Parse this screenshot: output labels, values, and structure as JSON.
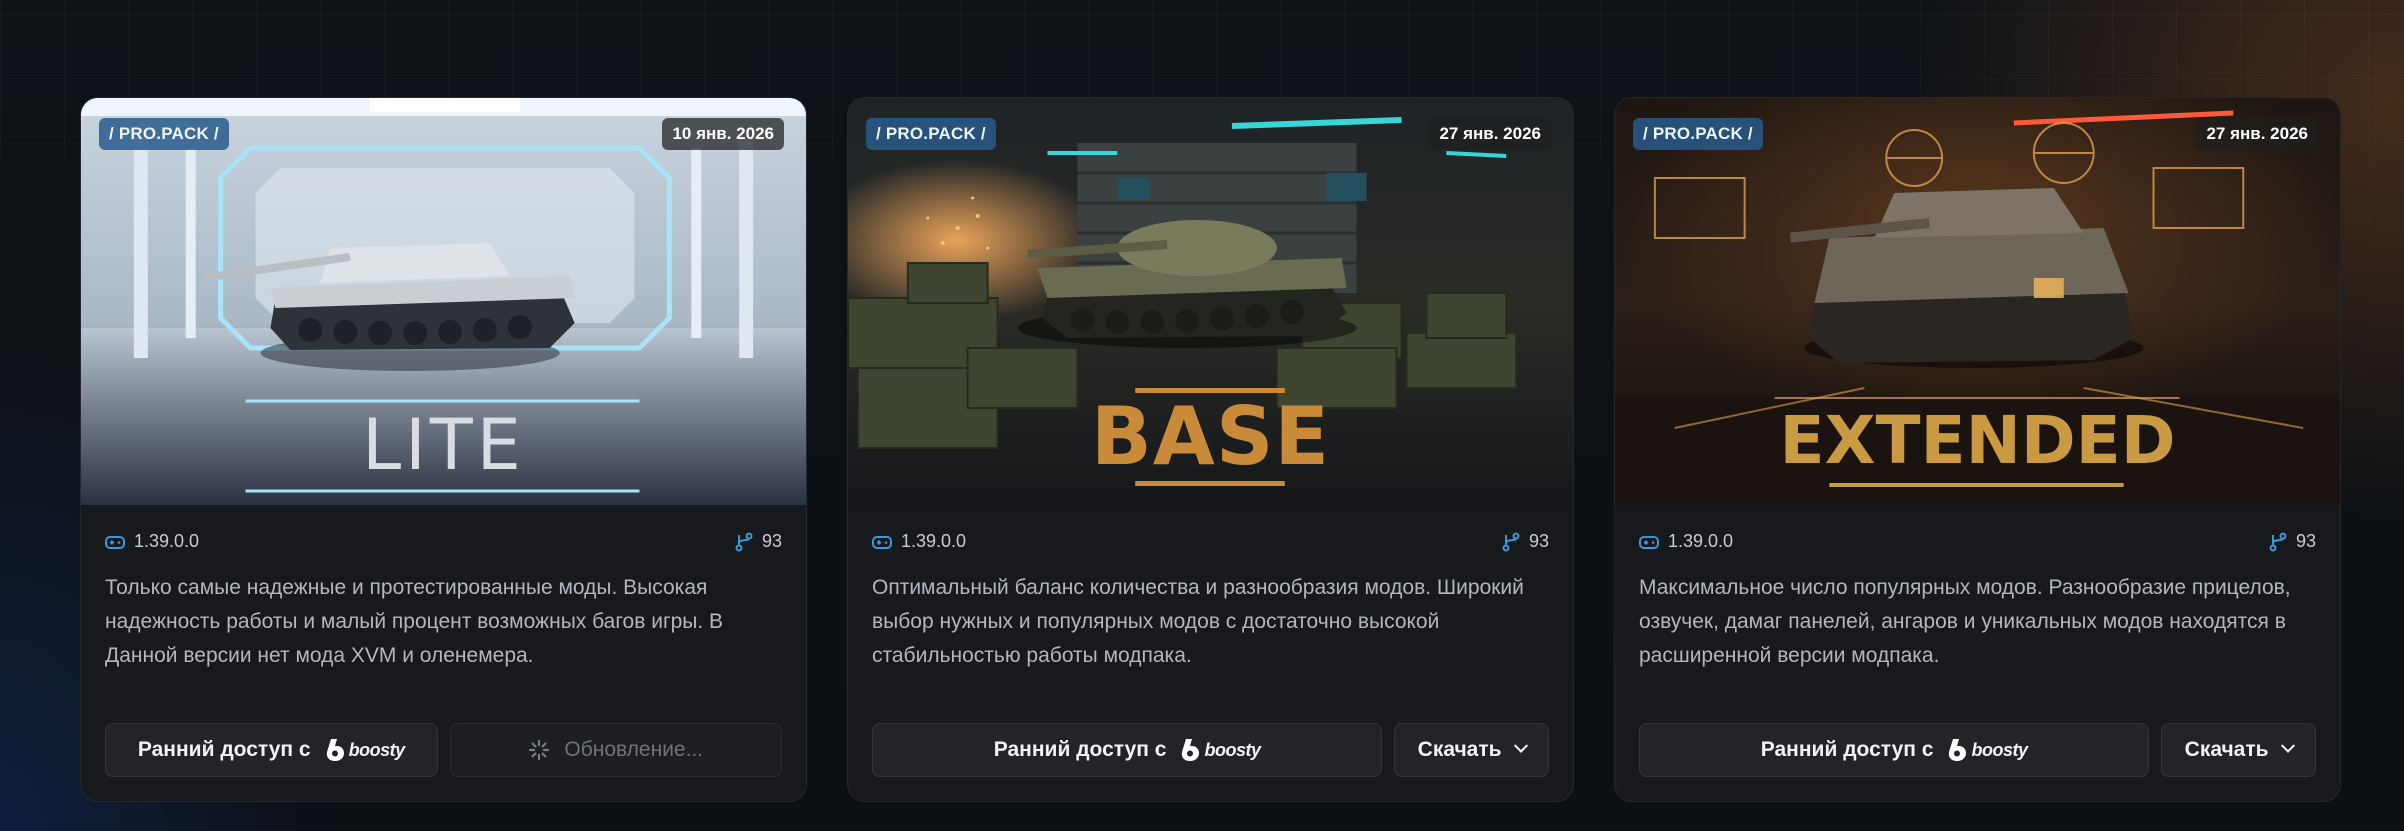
{
  "cards": [
    {
      "tag": "/ PRO.PACK /",
      "date": "10 янв. 2026",
      "hero_title": "LITE",
      "version": "1.39.0.0",
      "mods_count": "93",
      "description": "Только самые надежные и протестированные моды. Высокая надежность работы и малый процент возможных багов игры. В Данной версии нет мода XVM и оленемера.",
      "early_access_label": "Ранний доступ с",
      "boosty_label": "boosty",
      "secondary_label": "Обновление...",
      "secondary_state": "loading"
    },
    {
      "tag": "/ PRO.PACK /",
      "date": "27 янв. 2026",
      "hero_title": "BASE",
      "version": "1.39.0.0",
      "mods_count": "93",
      "description": "Оптимальный баланс количества и разнообразия модов. Широкий выбор нужных и популярных модов с достаточно высокой стабильностью работы модпака.",
      "early_access_label": "Ранний доступ с",
      "boosty_label": "boosty",
      "secondary_label": "Скачать",
      "secondary_state": "dropdown"
    },
    {
      "tag": "/ PRO.PACK /",
      "date": "27 янв. 2026",
      "hero_title": "EXTENDED",
      "version": "1.39.0.0",
      "mods_count": "93",
      "description": "Максимальное число популярных модов. Разнообразие прицелов, озвучек, дамаг панелей, ангаров и уникальных модов находятся в расширенной версии модпака.",
      "early_access_label": "Ранний доступ с",
      "boosty_label": "boosty",
      "secondary_label": "Скачать",
      "secondary_state": "dropdown"
    }
  ],
  "icons": {
    "version": "gamepad-icon",
    "mods": "branch-icon",
    "boosty": "boosty-logo-icon",
    "loading": "spinner-icon",
    "dropdown": "chevron-down-icon"
  },
  "colors": {
    "accent_blue": "#3a9ad9",
    "tag_bg": "#285a8c",
    "card_bg": "#17191d",
    "base_title": "#c98a3a",
    "extended_title": "#c99a42",
    "lite_title": "#d9dde2"
  }
}
